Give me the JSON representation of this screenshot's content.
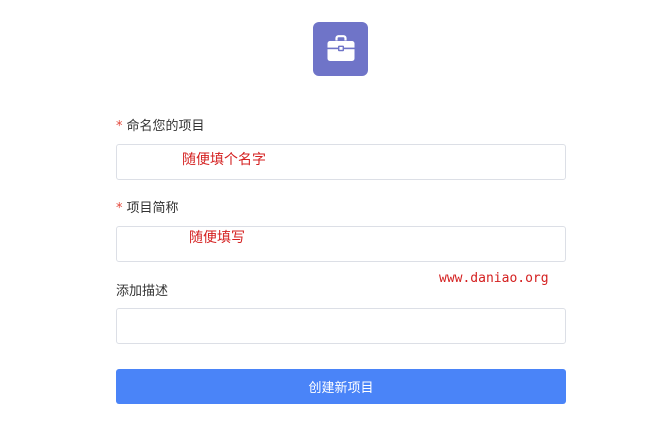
{
  "header": {
    "icon": "briefcase-icon",
    "icon_bg_color": "#6f74c8"
  },
  "form": {
    "required_mark": "*",
    "project_name": {
      "label": "命名您的项目",
      "value": "",
      "annotation": "随便填个名字"
    },
    "project_short": {
      "label": "项目简称",
      "value": "",
      "annotation": "随便填写"
    },
    "description": {
      "label": "添加描述",
      "value": ""
    },
    "submit_label": "创建新项目"
  },
  "watermark": "www.daniao.org",
  "colors": {
    "accent": "#4a84f8",
    "required": "#e3463a",
    "annotation": "#d42020",
    "border": "#dcdfe6"
  }
}
